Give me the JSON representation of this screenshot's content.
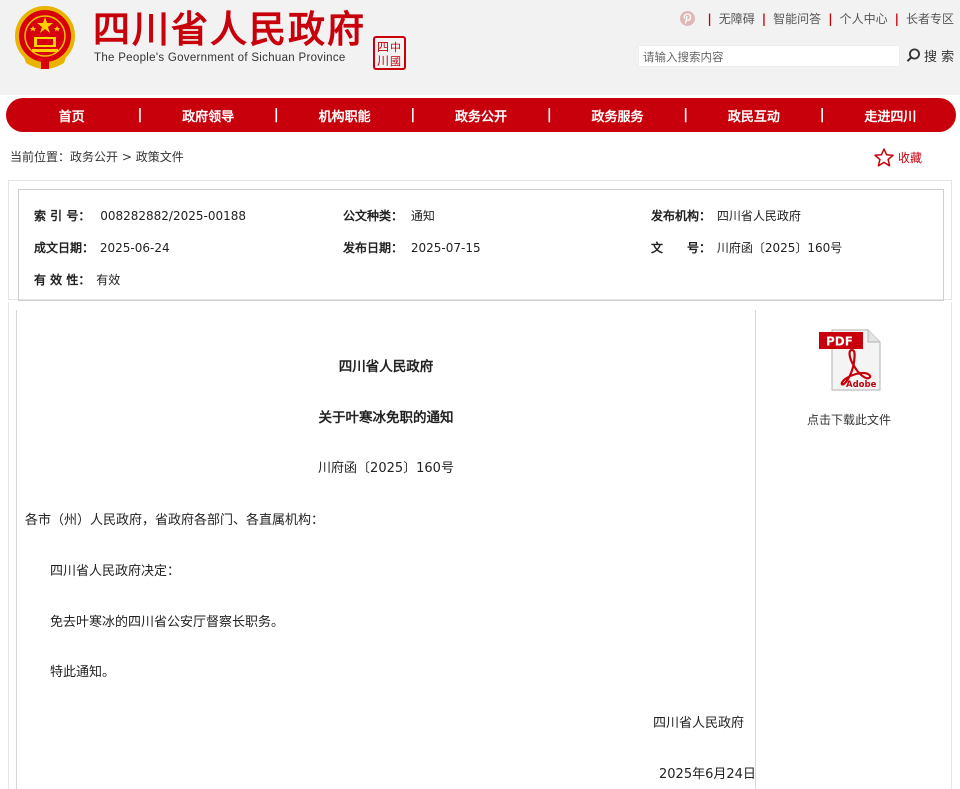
{
  "header": {
    "title_cn": "四川省人民政府",
    "title_en": "The People's Government of Sichuan Province",
    "seal_text": "四川",
    "links": [
      "无障碍",
      "智能问答",
      "个人中心",
      "长者专区"
    ],
    "search_placeholder": "请输入搜索内容",
    "search_label": "搜 索"
  },
  "nav": {
    "items": [
      "首页",
      "政府领导",
      "机构职能",
      "政务公开",
      "政务服务",
      "政民互动",
      "走进四川"
    ]
  },
  "breadcrumb": {
    "prefix": "当前位置：",
    "path": [
      "政务公开",
      "政策文件"
    ],
    "separator": " > "
  },
  "favorite_label": "收藏",
  "meta": {
    "index_label": "索 引 号：",
    "index_value": "008282882/2025-00188",
    "type_label": "公文种类：",
    "type_value": "通知",
    "issuer_label": "发布机构：",
    "issuer_value": "四川省人民政府",
    "created_label": "成文日期：",
    "created_value": "2025-06-24",
    "published_label": "发布日期：",
    "published_value": "2025-07-15",
    "docno_label": "文　　号：",
    "docno_value": "川府函〔2025〕160号",
    "validity_label": "有 效 性：",
    "validity_value": "有效"
  },
  "document": {
    "issuer": "四川省人民政府",
    "title": "关于叶寒冰免职的通知",
    "number": "川府函〔2025〕160号",
    "salutation": "各市（州）人民政府，省政府各部门、各直属机构：",
    "paragraphs": [
      "四川省人民政府决定：",
      "免去叶寒冰的四川省公安厅督察长职务。",
      "特此通知。"
    ],
    "sign_org": "四川省人民政府",
    "sign_date": "2025年6月24日"
  },
  "download": {
    "pdf_badge": "PDF",
    "adobe_label": "Adobe",
    "link_label": "点击下载此文件"
  },
  "colors": {
    "brand_red": "#c8000b",
    "header_bg": "#f2f2f2"
  }
}
